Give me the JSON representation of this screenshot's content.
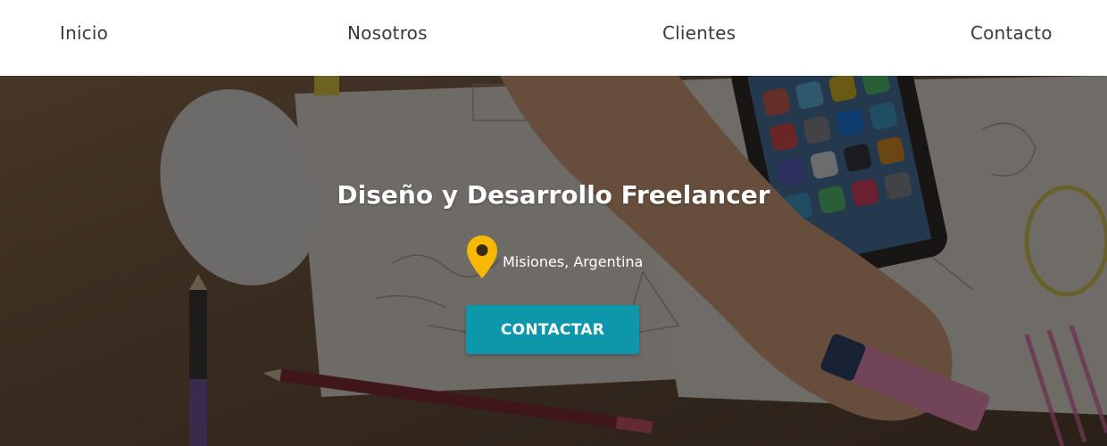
{
  "nav": {
    "items": [
      {
        "label": "Inicio"
      },
      {
        "label": "Nosotros"
      },
      {
        "label": "Clientes"
      },
      {
        "label": "Contacto"
      }
    ]
  },
  "hero": {
    "title": "Diseño y Desarrollo Freelancer",
    "location": "Misiones, Argentina",
    "location_icon": "map-pin-icon",
    "cta_label": "CONTACTAR"
  },
  "colors": {
    "accent": "#0e97aa",
    "pin": "#f6b800",
    "nav_text": "#3a3a3a"
  }
}
